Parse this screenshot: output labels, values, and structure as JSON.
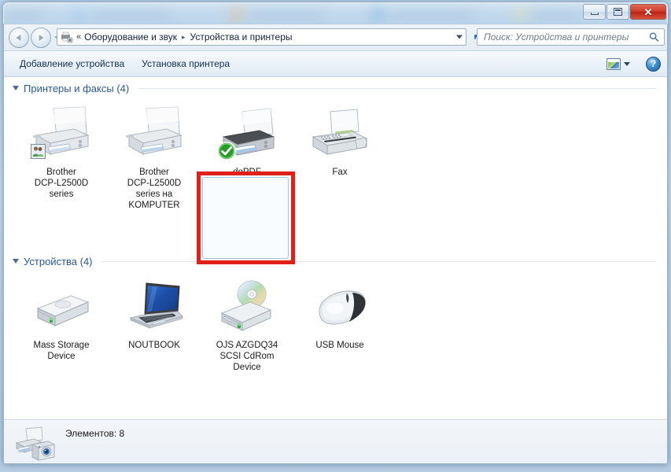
{
  "window": {
    "controls": {
      "minimize_label": "Свернуть",
      "maximize_label": "Развернуть",
      "close_label": "Закрыть",
      "close_glyph": "✕"
    }
  },
  "address_bar": {
    "back_tooltip": "Назад",
    "forward_tooltip": "Вперед",
    "icon": "devices-printers-icon",
    "chevrons": "«",
    "breadcrumbs": [
      {
        "label": "Оборудование и звук"
      },
      {
        "label": "Устройства и принтеры"
      }
    ],
    "separator": "▸",
    "refresh_glyph": "↻"
  },
  "search": {
    "placeholder": "Поиск: Устройства и принтеры",
    "value": "",
    "icon": "magnifier-icon"
  },
  "command_bar": {
    "items": [
      {
        "label": "Добавление устройства"
      },
      {
        "label": "Установка принтера"
      }
    ],
    "view_icon": "view-layout-icon",
    "help_label": "?"
  },
  "groups": [
    {
      "title": "Принтеры и факсы (4)",
      "items": [
        {
          "label": "Brother\nDCP-L2500D\nseries",
          "icon": "printer-icon",
          "badge": "shared-users-badge",
          "selected": false
        },
        {
          "label": "Brother\nDCP-L2500D\nseries на\nKOMPUTER",
          "icon": "printer-icon",
          "badge": "",
          "selected": false
        },
        {
          "label": "doPDF",
          "icon": "printer-dark-icon",
          "badge": "default-printer-check",
          "selected": true
        },
        {
          "label": "Fax",
          "icon": "fax-icon",
          "badge": "",
          "selected": false
        }
      ]
    },
    {
      "title": "Устройства (4)",
      "items": [
        {
          "label": "Mass Storage\nDevice",
          "icon": "external-drive-icon",
          "badge": "",
          "selected": false
        },
        {
          "label": "NOUTBOOK",
          "icon": "laptop-icon",
          "badge": "",
          "selected": false
        },
        {
          "label": "OJS AZGDQ34\nSCSI CdRom\nDevice",
          "icon": "cdrom-icon",
          "badge": "",
          "selected": false
        },
        {
          "label": "USB Mouse",
          "icon": "mouse-icon",
          "badge": "",
          "selected": false
        }
      ]
    }
  ],
  "status_bar": {
    "icon": "devices-summary-icon",
    "text": "Элементов: 8"
  },
  "annotation": {
    "highlight_color": "#e0211b",
    "target": "doPDF"
  },
  "colors": {
    "group_title": "#2a5a96",
    "accent": "#1d62b5",
    "selection_border": "#9fc4db",
    "content_bg": "#ffffff"
  }
}
